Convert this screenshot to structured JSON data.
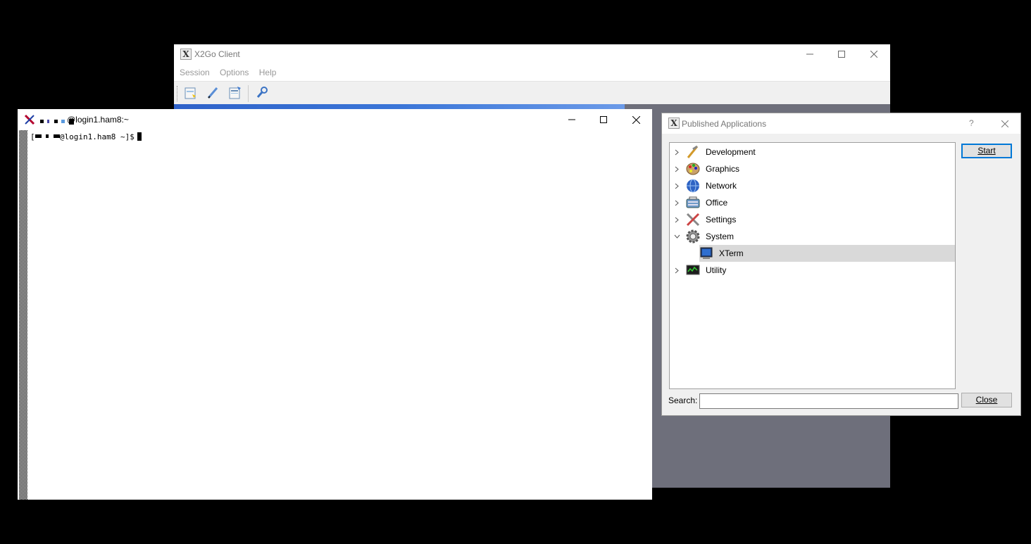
{
  "x2go_window": {
    "title": "X2Go Client",
    "logo_glyph": "X",
    "menu": [
      "Session",
      "Options",
      "Help"
    ],
    "toolbar_icons": [
      "new-session-icon",
      "edit-session-icon",
      "session-export-icon",
      "preferences-wrench-icon"
    ]
  },
  "xterm_window": {
    "title": "@login1.ham8:~",
    "prompt_host": "@login1.ham8 ~]$",
    "prompt_open_bracket": "["
  },
  "published_apps_dialog": {
    "title": "Published Applications",
    "help_glyph": "?",
    "tree": [
      {
        "label": "Development",
        "icon": "development-tools-icon",
        "expanded": false
      },
      {
        "label": "Graphics",
        "icon": "graphics-palette-icon",
        "expanded": false
      },
      {
        "label": "Network",
        "icon": "network-globe-icon",
        "expanded": false
      },
      {
        "label": "Office",
        "icon": "office-typewriter-icon",
        "expanded": false
      },
      {
        "label": "Settings",
        "icon": "settings-tools-icon",
        "expanded": false
      },
      {
        "label": "System",
        "icon": "system-gear-icon",
        "expanded": true
      },
      {
        "label": "XTerm",
        "icon": "xterm-terminal-icon",
        "child": true,
        "selected": true
      },
      {
        "label": "Utility",
        "icon": "utility-monitor-icon",
        "expanded": false
      }
    ],
    "start_label": "Start",
    "close_label": "Close",
    "search_label": "Search:",
    "search_value": ""
  }
}
